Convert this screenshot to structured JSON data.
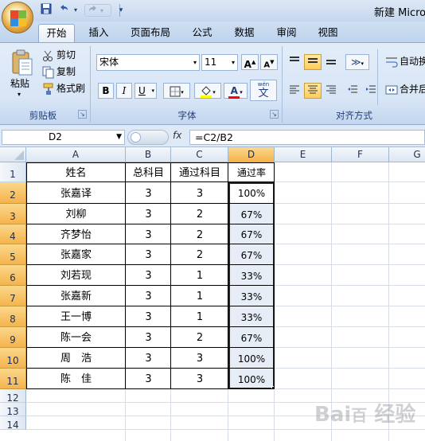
{
  "window": {
    "title": "新建 Micros"
  },
  "quick_access": {
    "save_icon": "save-icon",
    "undo_icon": "undo-icon",
    "redo_icon": "redo-icon",
    "customize_icon": "chevron-down-icon"
  },
  "tabs": [
    {
      "label": "开始",
      "active": true
    },
    {
      "label": "插入"
    },
    {
      "label": "页面布局"
    },
    {
      "label": "公式"
    },
    {
      "label": "数据"
    },
    {
      "label": "审阅"
    },
    {
      "label": "视图"
    }
  ],
  "ribbon": {
    "clipboard": {
      "label": "剪贴板",
      "paste": "粘贴",
      "cut": "剪切",
      "copy": "复制",
      "format_painter": "格式刷"
    },
    "font": {
      "label": "字体",
      "font_name": "宋体",
      "font_size": "11",
      "grow": "A",
      "shrink": "A",
      "bold": "B",
      "italic": "I",
      "underline": "U",
      "font_color_letter": "A",
      "phonetic": "wén",
      "phonetic_char": "文",
      "fill_color": "#ffff00",
      "font_color": "#ff0000"
    },
    "alignment": {
      "label": "对齐方式",
      "wrap": "自动换",
      "merge": "合并后"
    }
  },
  "formula_bar": {
    "name_box": "D2",
    "fx": "fx",
    "formula": "=C2/B2"
  },
  "columns": [
    "A",
    "B",
    "C",
    "D",
    "E",
    "F",
    "G"
  ],
  "rows": [
    "1",
    "2",
    "3",
    "4",
    "5",
    "6",
    "7",
    "8",
    "9",
    "10",
    "11",
    "12",
    "13",
    "14"
  ],
  "sheet": {
    "headers": [
      "姓名",
      "总科目",
      "通过科目",
      "通过率"
    ],
    "rows": [
      [
        "张嘉译",
        "3",
        "3",
        "100%"
      ],
      [
        "刘柳",
        "3",
        "2",
        "67%"
      ],
      [
        "齐梦怡",
        "3",
        "2",
        "67%"
      ],
      [
        "张嘉家",
        "3",
        "2",
        "67%"
      ],
      [
        "刘若现",
        "3",
        "1",
        "33%"
      ],
      [
        "张嘉新",
        "3",
        "1",
        "33%"
      ],
      [
        "王一博",
        "3",
        "1",
        "33%"
      ],
      [
        "陈一会",
        "3",
        "2",
        "67%"
      ],
      [
        "周　浩",
        "3",
        "3",
        "100%"
      ],
      [
        "陈　佳",
        "3",
        "3",
        "100%"
      ]
    ]
  },
  "watermark": "Bai百 经验",
  "colors": {
    "selection_fill": "#e7edf7",
    "header_highlight": "#f5b34c",
    "ribbon": "#dbe7f6"
  }
}
